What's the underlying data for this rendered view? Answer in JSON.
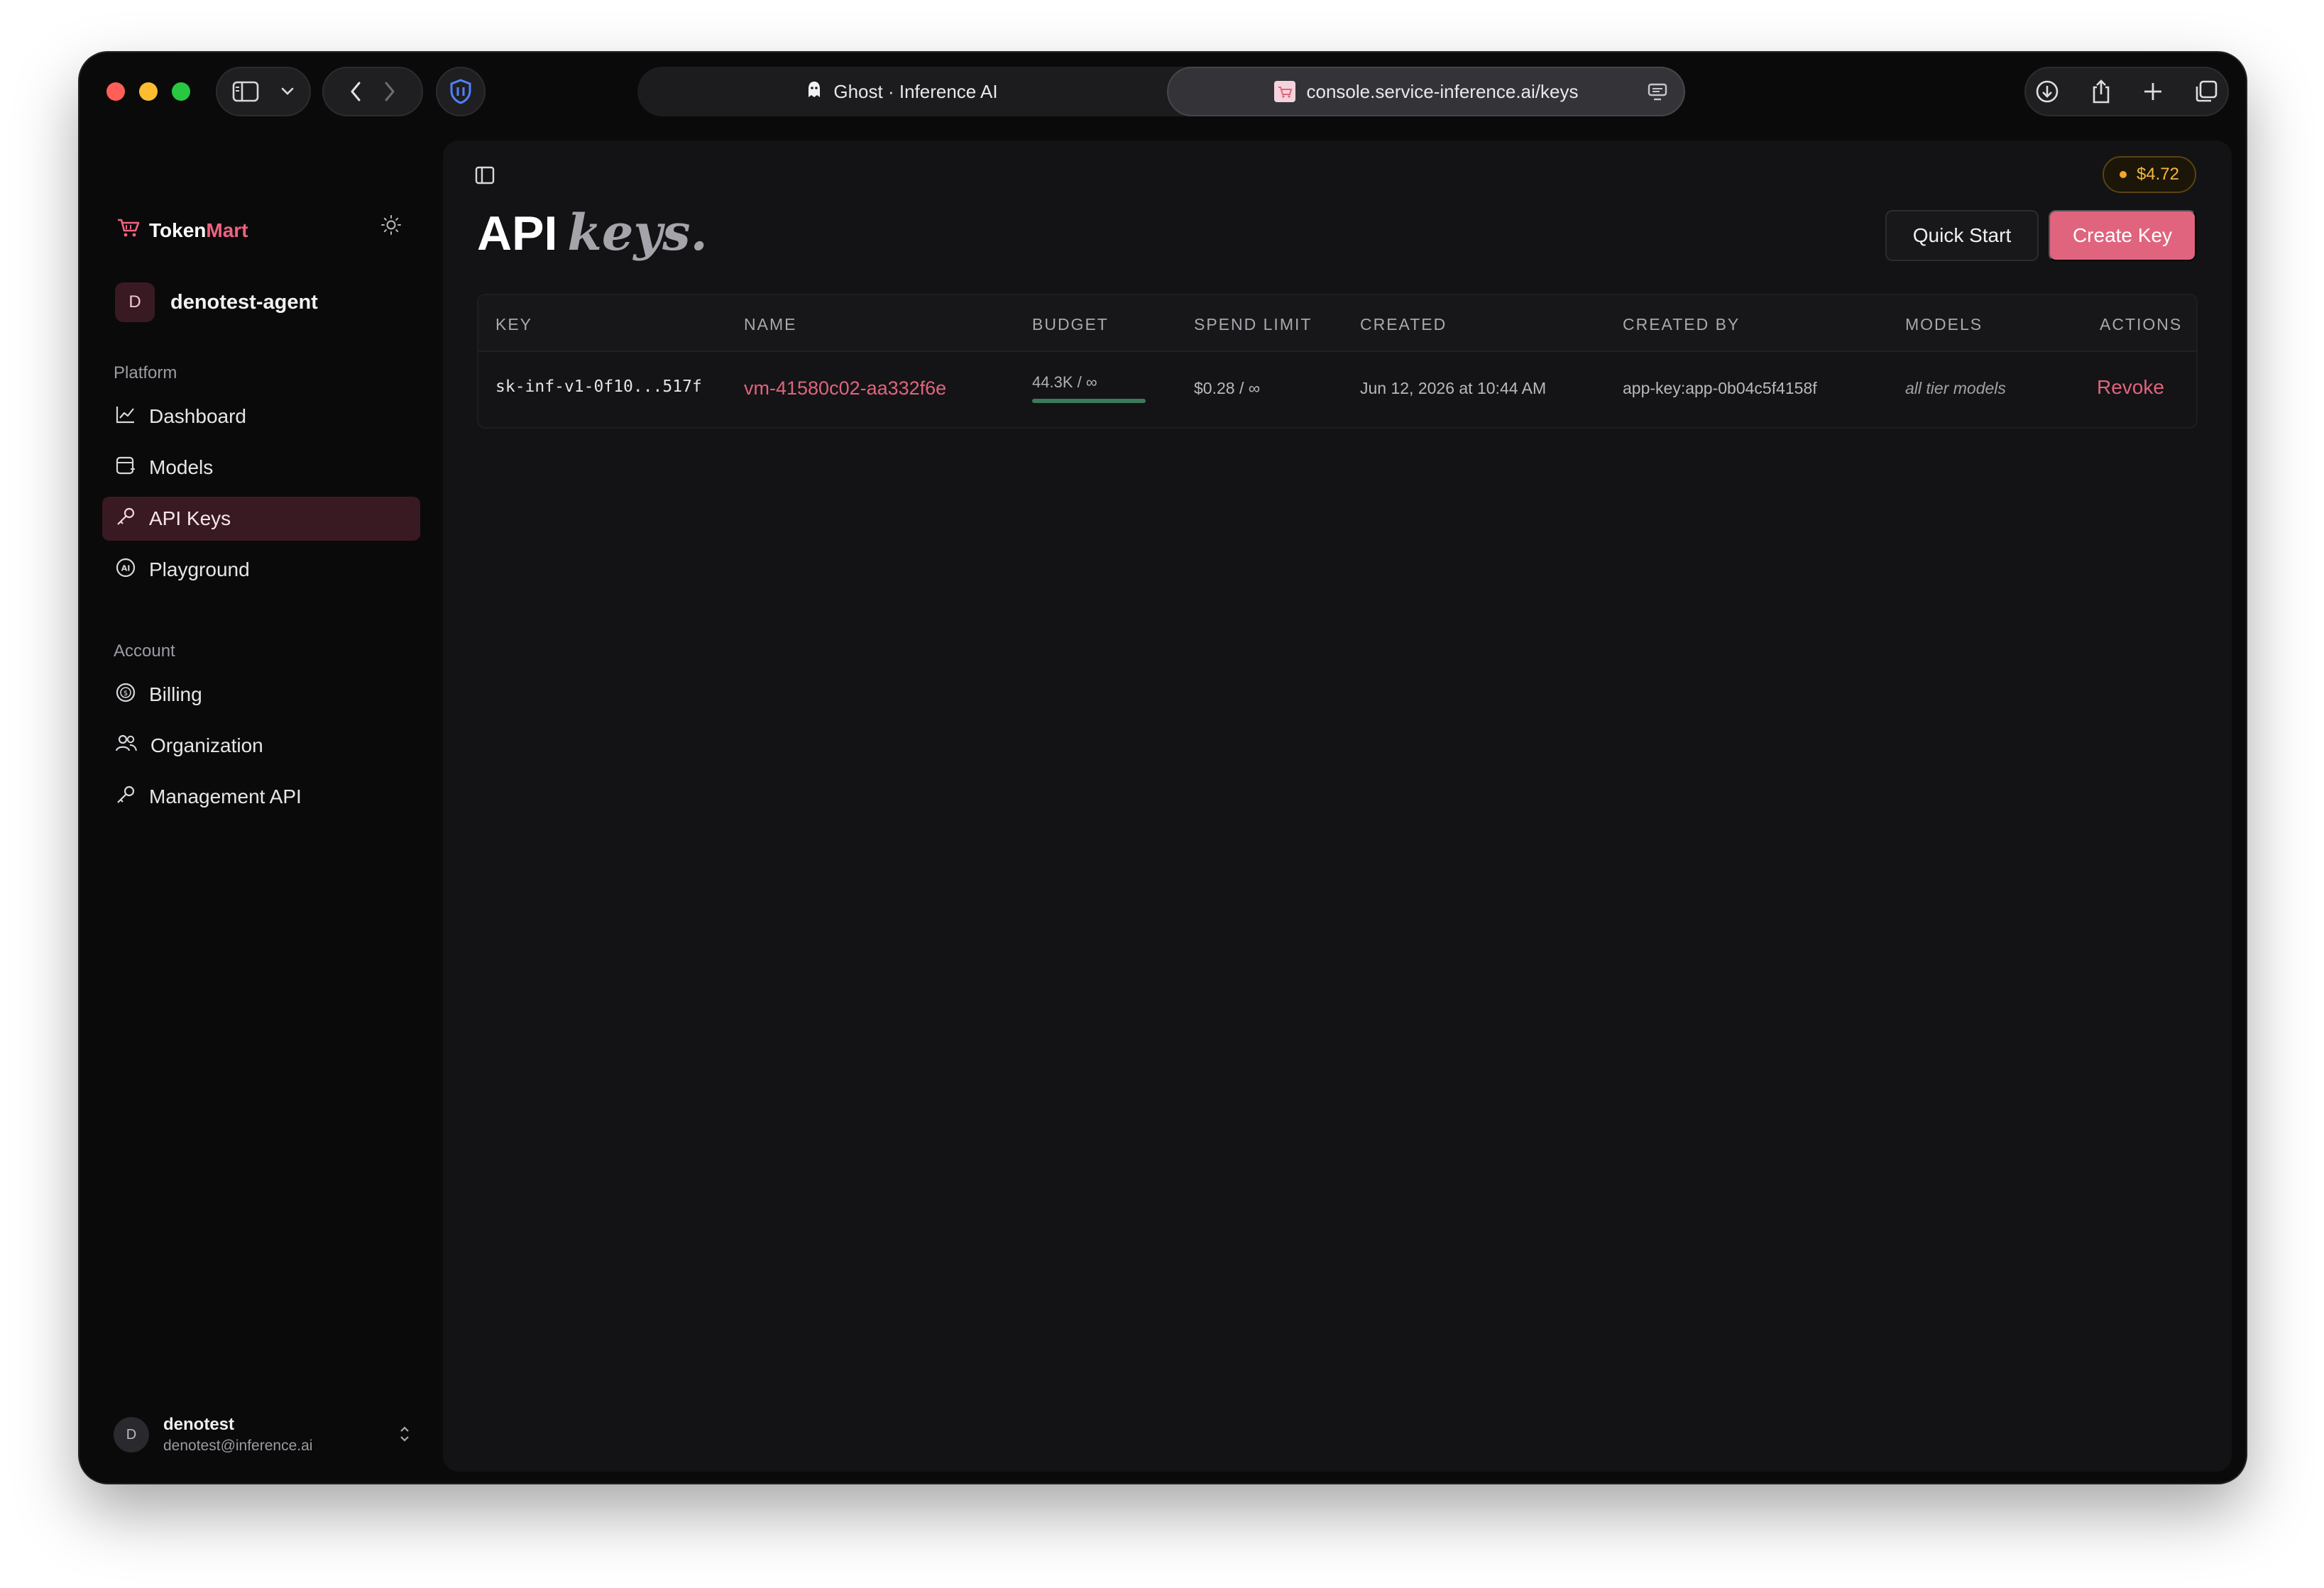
{
  "browser": {
    "tabs": [
      {
        "label": "Ghost · Inference AI"
      },
      {
        "label": "console.service-inference.ai/keys"
      }
    ]
  },
  "sidebar": {
    "brand": {
      "part1": "Token",
      "part2": "Mart"
    },
    "org": {
      "initial": "D",
      "name": "denotest-agent"
    },
    "platform_label": "Platform",
    "platform_items": [
      {
        "label": "Dashboard",
        "icon": "chart-line-icon"
      },
      {
        "label": "Models",
        "icon": "models-icon"
      },
      {
        "label": "API Keys",
        "icon": "key-icon",
        "active": true
      },
      {
        "label": "Playground",
        "icon": "ai-badge-icon"
      }
    ],
    "account_label": "Account",
    "account_items": [
      {
        "label": "Billing",
        "icon": "dollar-circle-icon"
      },
      {
        "label": "Organization",
        "icon": "users-icon"
      },
      {
        "label": "Management API",
        "icon": "key-icon"
      }
    ],
    "user": {
      "initial": "D",
      "name": "denotest",
      "email": "denotest@inference.ai"
    }
  },
  "header": {
    "balance": "$4.72",
    "title_main": "API",
    "title_em": "keys.",
    "quick_start": "Quick Start",
    "create_key": "Create Key"
  },
  "table": {
    "columns": [
      "KEY",
      "NAME",
      "BUDGET",
      "SPEND LIMIT",
      "CREATED",
      "CREATED BY",
      "MODELS",
      "ACTIONS"
    ],
    "rows": [
      {
        "key": "sk-inf-v1-0f10...517f",
        "name": "vm-41580c02-aa332f6e",
        "budget": "44.3K / ∞",
        "budget_fraction": 1.0,
        "spend_limit": "$0.28 / ∞",
        "created": "Jun 12, 2026 at 10:44 AM",
        "created_by": "app-key:app-0b04c5f4158f",
        "models": "all tier models",
        "action": "Revoke"
      }
    ]
  },
  "colors": {
    "accent": "#e0647e",
    "balance": "#f5b83d",
    "budget_bar": "#3d7a5c"
  }
}
